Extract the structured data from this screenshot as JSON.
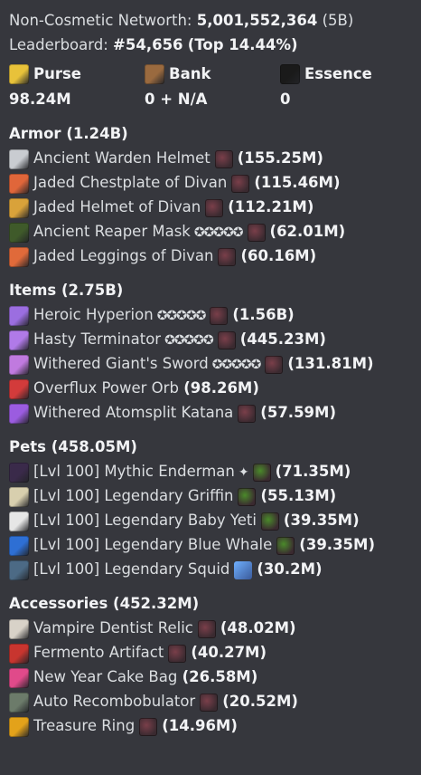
{
  "networth": {
    "label": "Non-Cosmetic Networth:",
    "value": "5,001,552,364",
    "short": "(5B)"
  },
  "leaderboard": {
    "label": "Leaderboard:",
    "rank": "#54,656",
    "top": "(Top 14.44%)"
  },
  "balances": [
    {
      "name": "Purse",
      "value": "98.24M",
      "icon": "gold-ingot-icon",
      "color": "#e8c23a"
    },
    {
      "name": "Bank",
      "value": "0 + N/A",
      "icon": "money-bag-icon",
      "color": "#9a6a3f"
    },
    {
      "name": "Essence",
      "value": "0",
      "icon": "essence-orb-icon",
      "color": "#1a1a1a"
    }
  ],
  "sections": [
    {
      "title": "Armor (1.24B)",
      "items": [
        {
          "text": "Ancient Warden Helmet",
          "stars": "",
          "gem": true,
          "value": "(155.25M)",
          "icon": "warden-helmet-icon",
          "color": "#c9ccd1"
        },
        {
          "text": "Jaded Chestplate of Divan",
          "stars": "",
          "gem": true,
          "value": "(115.46M)",
          "icon": "divan-chestplate-icon",
          "color": "#e0663a"
        },
        {
          "text": "Jaded Helmet of Divan",
          "stars": "",
          "gem": true,
          "value": "(112.21M)",
          "icon": "divan-helmet-icon",
          "color": "#d9a23a"
        },
        {
          "text": "Ancient Reaper Mask",
          "stars": "✪✪✪✪✪",
          "gem": true,
          "value": "(62.01M)",
          "icon": "reaper-mask-icon",
          "color": "#3f5a2a"
        },
        {
          "text": "Jaded Leggings of Divan",
          "stars": "",
          "gem": true,
          "value": "(60.16M)",
          "icon": "divan-leggings-icon",
          "color": "#e06a3a"
        }
      ]
    },
    {
      "title": "Items (2.75B)",
      "items": [
        {
          "text": "Heroic Hyperion",
          "stars": "✪✪✪✪✪",
          "gem": true,
          "value": "(1.56B)",
          "icon": "hyperion-sword-icon",
          "color": "#9b6ee0"
        },
        {
          "text": "Hasty Terminator",
          "stars": "✪✪✪✪✪",
          "gem": true,
          "value": "(445.23M)",
          "icon": "terminator-bow-icon",
          "color": "#b07ae8"
        },
        {
          "text": "Withered Giant's Sword",
          "stars": "✪✪✪✪✪",
          "gem": true,
          "value": "(131.81M)",
          "icon": "giant-sword-icon",
          "color": "#c07adf"
        },
        {
          "text": "Overflux Power Orb",
          "stars": "",
          "gem": false,
          "value": "(98.26M)",
          "icon": "power-orb-icon",
          "color": "#d33b3b"
        },
        {
          "text": "Withered Atomsplit Katana",
          "stars": "",
          "gem": true,
          "value": "(57.59M)",
          "icon": "katana-icon",
          "color": "#9b5ce0"
        }
      ]
    },
    {
      "title": "Pets (458.05M)",
      "items": [
        {
          "text": "[Lvl 100] Mythic Enderman",
          "stars": "✦",
          "gem": true,
          "gemColor": "#4a8a2a",
          "value": "(71.35M)",
          "icon": "enderman-pet-icon",
          "color": "#3a2a4a"
        },
        {
          "text": "[Lvl 100] Legendary Griffin",
          "stars": "",
          "gem": true,
          "gemColor": "#4a8a2a",
          "value": "(55.13M)",
          "icon": "griffin-pet-icon",
          "color": "#d8cfae"
        },
        {
          "text": "[Lvl 100] Legendary Baby Yeti",
          "stars": "",
          "gem": true,
          "gemColor": "#4a8a2a",
          "value": "(39.35M)",
          "icon": "yeti-pet-icon",
          "color": "#e6e6e6"
        },
        {
          "text": "[Lvl 100] Legendary Blue Whale",
          "stars": "",
          "gem": true,
          "gemColor": "#4a8a2a",
          "value": "(39.35M)",
          "icon": "whale-pet-icon",
          "color": "#2e6fd4"
        },
        {
          "text": "[Lvl 100] Legendary Squid",
          "stars": "",
          "gem": false,
          "extra": "trident-icon",
          "value": "(30.2M)",
          "icon": "squid-pet-icon",
          "color": "#4c6a85"
        }
      ]
    },
    {
      "title": "Accessories (452.32M)",
      "items": [
        {
          "text": "Vampire Dentist Relic",
          "stars": "",
          "gem": true,
          "value": "(48.02M)",
          "icon": "dentist-relic-icon",
          "color": "#d8d2c8"
        },
        {
          "text": "Fermento Artifact",
          "stars": "",
          "gem": true,
          "value": "(40.27M)",
          "icon": "fermento-icon",
          "color": "#c8352f"
        },
        {
          "text": "New Year Cake Bag",
          "stars": "",
          "gem": false,
          "value": "(26.58M)",
          "icon": "cake-bag-icon",
          "color": "#e04a8a"
        },
        {
          "text": "Auto Recombobulator",
          "stars": "",
          "gem": true,
          "value": "(20.52M)",
          "icon": "recombobulator-icon",
          "color": "#6c7b6a"
        },
        {
          "text": "Treasure Ring",
          "stars": "",
          "gem": true,
          "value": "(14.96M)",
          "icon": "treasure-ring-icon",
          "color": "#e3a21a"
        }
      ]
    }
  ]
}
